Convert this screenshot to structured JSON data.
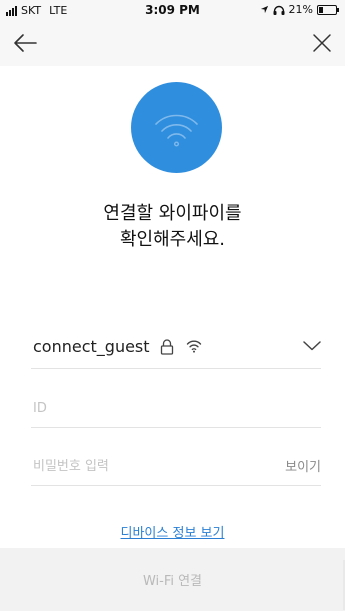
{
  "status_bar": {
    "carrier": "SKT",
    "network": "LTE",
    "time": "3:09 PM",
    "battery_percent": "21%"
  },
  "nav": {
    "back_icon": "arrow-left-icon",
    "close_icon": "close-icon"
  },
  "hero": {
    "icon": "wifi-icon",
    "color": "#2f8ede"
  },
  "headline": {
    "line1": "연결할 와이파이를",
    "line2": "확인해주세요."
  },
  "network": {
    "ssid": "connect_guest",
    "secured_icon": "lock-icon",
    "signal_icon": "wifi-signal-icon",
    "dropdown_icon": "chevron-down-icon"
  },
  "form": {
    "id_placeholder": "ID",
    "password_placeholder": "비밀번호 입력",
    "show_password_label": "보이기"
  },
  "links": {
    "device_info": "디바이스 정보 보기"
  },
  "actions": {
    "connect_label": "Wi-Fi 연결"
  },
  "colors": {
    "accent": "#2f8ede",
    "link": "#2a7fd4",
    "disabled_text": "#b9b9b9"
  }
}
